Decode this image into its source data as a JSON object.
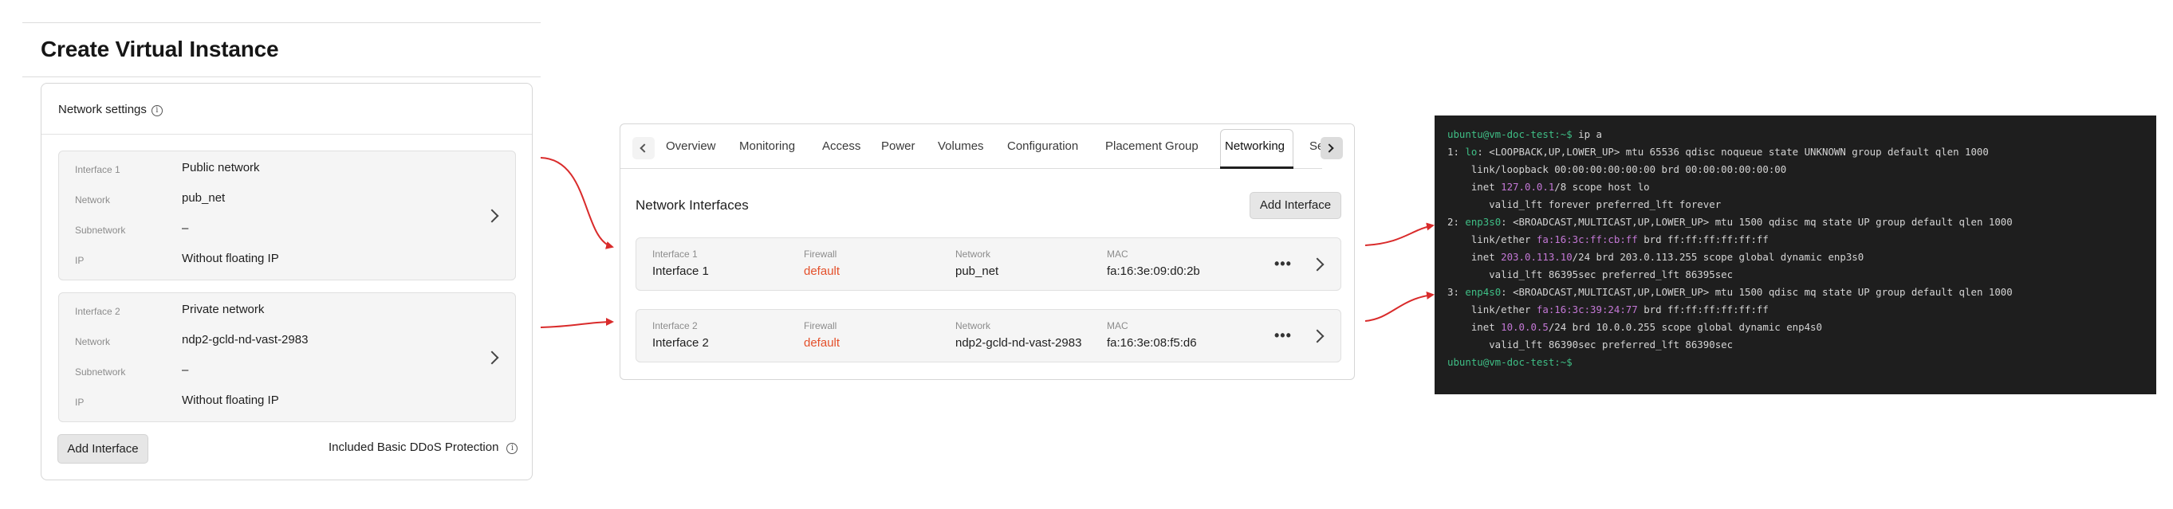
{
  "left": {
    "page_title": "Create Virtual Instance",
    "section_title": "Network settings",
    "info_icon": "i",
    "interfaces": [
      {
        "name_label": "Interface 1",
        "name_value": "Public network",
        "network_label": "Network",
        "network_value": "pub_net",
        "subnetwork_label": "Subnetwork",
        "subnetwork_value": "–",
        "ip_label": "IP",
        "ip_value": "Without floating IP"
      },
      {
        "name_label": "Interface 2",
        "name_value": "Private network",
        "network_label": "Network",
        "network_value": "ndp2-gcld-nd-vast-2983",
        "subnetwork_label": "Subnetwork",
        "subnetwork_value": "–",
        "ip_label": "IP",
        "ip_value": "Without floating IP"
      }
    ],
    "add_interface_label": "Add Interface",
    "ddos_label": "Included Basic DDoS Protection"
  },
  "middle": {
    "tabs": [
      "Overview",
      "Monitoring",
      "Access",
      "Power",
      "Volumes",
      "Configuration",
      "Placement Group",
      "Networking",
      "Se"
    ],
    "active_tab": "Networking",
    "heading": "Network Interfaces",
    "add_interface_label": "Add Interface",
    "rows": [
      {
        "iface_label": "Interface 1",
        "iface_value": "Interface 1",
        "firewall_label": "Firewall",
        "firewall_value": "default",
        "network_label": "Network",
        "network_value": "pub_net",
        "mac_label": "MAC",
        "mac_value": "fa:16:3e:09:d0:2b"
      },
      {
        "iface_label": "Interface 2",
        "iface_value": "Interface 2",
        "firewall_label": "Firewall",
        "firewall_value": "default",
        "network_label": "Network",
        "network_value": "ndp2-gcld-nd-vast-2983",
        "mac_label": "MAC",
        "mac_value": "fa:16:3e:08:f5:d6"
      }
    ],
    "more_icon": "•••"
  },
  "terminal": {
    "prompt": "ubuntu@vm-doc-test:~$",
    "command": " ip a",
    "lo_num": "1: ",
    "lo_name": "lo",
    "lo_rest": ": <LOOPBACK,UP,LOWER_UP> mtu 65536 qdisc noqueue state UNKNOWN group default qlen 1000",
    "lo_link": "    link/loopback 00:00:00:00:00:00 brd 00:00:00:00:00:00",
    "lo_inet_pre": "    inet ",
    "lo_inet_addr": "127.0.0.1",
    "lo_inet_post": "/8 scope host lo",
    "lo_valid": "       valid_lft forever preferred_lft forever",
    "e3_num": "2: ",
    "e3_name": "enp3s0",
    "e3_rest": ": <BROADCAST,MULTICAST,UP,LOWER_UP> mtu 1500 qdisc mq state UP group default qlen 1000",
    "e3_link_pre": "    link/ether ",
    "e3_mac": "fa:16:3c:ff:cb:ff",
    "e3_link_post": " brd ff:ff:ff:ff:ff:ff",
    "e3_inet_pre": "    inet ",
    "e3_inet_addr": "203.0.113.10",
    "e3_inet_post": "/24 brd 203.0.113.255 scope global dynamic enp3s0",
    "e3_valid": "       valid_lft 86395sec preferred_lft 86395sec",
    "e4_num": "3: ",
    "e4_name": "enp4s0",
    "e4_rest": ": <BROADCAST,MULTICAST,UP,LOWER_UP> mtu 1500 qdisc mq state UP group default qlen 1000",
    "e4_link_pre": "    link/ether ",
    "e4_mac": "fa:16:3c:39:24:77",
    "e4_link_post": " brd ff:ff:ff:ff:ff:ff",
    "e4_inet_pre": "    inet ",
    "e4_inet_addr": "10.0.0.5",
    "e4_inet_post": "/24 brd 10.0.0.255 scope global dynamic enp4s0",
    "e4_valid": "       valid_lft 86390sec preferred_lft 86390sec",
    "final_prompt": "ubuntu@vm-doc-test:~$"
  },
  "colors": {
    "firewall_default": "#e4502b",
    "arrow": "#d92b2b",
    "terminal_bg": "#1e1e1e",
    "terminal_green": "#3fbf86",
    "terminal_magenta": "#c478d6"
  }
}
